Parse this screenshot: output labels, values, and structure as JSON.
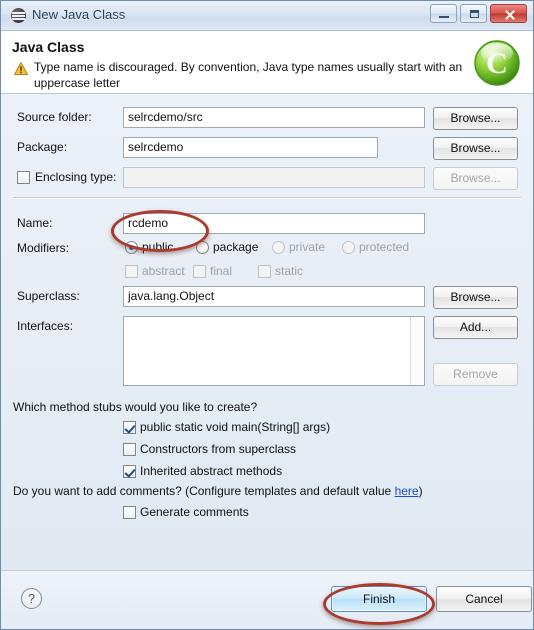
{
  "window": {
    "title": "New Java Class",
    "icon": "eclipse-wizard-icon",
    "buttons": {
      "minimize": "minimize-icon",
      "maximize": "maximize-icon",
      "close": "close-icon"
    }
  },
  "header": {
    "title": "Java Class",
    "warning_icon": "warning-icon",
    "warning_text": "Type name is discouraged. By convention, Java type names usually start with an uppercase letter",
    "badge_icon": "java-class-icon",
    "badge_letter": "C"
  },
  "form": {
    "source_folder": {
      "label": "Source folder:",
      "value": "selrcdemo/src",
      "browse": "Browse..."
    },
    "package": {
      "label": "Package:",
      "value": "selrcdemo",
      "browse": "Browse..."
    },
    "enclosing_type": {
      "label": "Enclosing type:",
      "value": "",
      "checked": false,
      "browse": "Browse...",
      "disabled": true
    },
    "name": {
      "label": "Name:",
      "value": "rcdemo"
    },
    "modifiers": {
      "label": "Modifiers:",
      "radios": [
        {
          "label": "public",
          "checked": true,
          "disabled": false
        },
        {
          "label": "package",
          "checked": false,
          "disabled": false
        },
        {
          "label": "private",
          "checked": false,
          "disabled": true
        },
        {
          "label": "protected",
          "checked": false,
          "disabled": true
        }
      ],
      "checkboxes": [
        {
          "label": "abstract",
          "checked": false,
          "disabled": true
        },
        {
          "label": "final",
          "checked": false,
          "disabled": true
        },
        {
          "label": "static",
          "checked": false,
          "disabled": true
        }
      ]
    },
    "superclass": {
      "label": "Superclass:",
      "value": "java.lang.Object",
      "browse": "Browse..."
    },
    "interfaces": {
      "label": "Interfaces:",
      "items": [],
      "add": "Add...",
      "remove": "Remove"
    }
  },
  "stubs": {
    "question": "Which method stubs would you like to create?",
    "options": [
      {
        "label": "public static void main(String[] args)",
        "checked": true
      },
      {
        "label": "Constructors from superclass",
        "checked": false
      },
      {
        "label": "Inherited abstract methods",
        "checked": true
      }
    ]
  },
  "comments": {
    "question_prefix": "Do you want to add comments? (Configure templates and default value ",
    "link": "here",
    "question_suffix": ")",
    "option": {
      "label": "Generate comments",
      "checked": false
    }
  },
  "footer": {
    "help": "?",
    "finish": "Finish",
    "cancel": "Cancel"
  },
  "annotations": {
    "name_highlight": "red-ellipse-around-name-field",
    "finish_highlight": "red-ellipse-around-finish-button",
    "color": "#a83c2e"
  }
}
